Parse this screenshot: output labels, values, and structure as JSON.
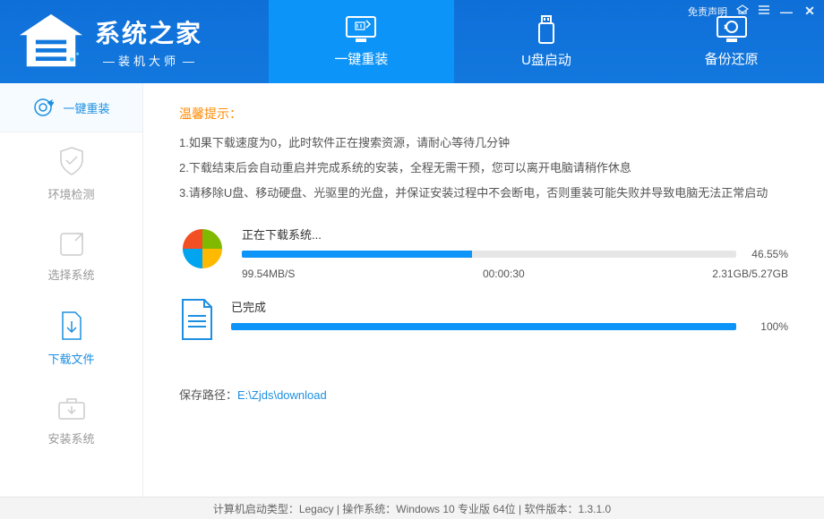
{
  "header": {
    "logo_title": "系统之家",
    "logo_sub": "装机大师",
    "tabs": [
      {
        "label": "一键重装"
      },
      {
        "label": "U盘启动"
      },
      {
        "label": "备份还原"
      }
    ],
    "disclaimer": "免责声明"
  },
  "sidebar": {
    "items": [
      {
        "label": "一键重装"
      },
      {
        "label": "环境检测"
      },
      {
        "label": "选择系统"
      },
      {
        "label": "下载文件"
      },
      {
        "label": "安装系统"
      }
    ]
  },
  "tips": {
    "title": "温馨提示：",
    "lines": [
      "1.如果下载速度为0，此时软件正在搜索资源，请耐心等待几分钟",
      "2.下载结束后会自动重启并完成系统的安装，全程无需干预，您可以离开电脑请稍作休息",
      "3.请移除U盘、移动硬盘、光驱里的光盘，并保证安装过程中不会断电，否则重装可能失败并导致电脑无法正常启动"
    ]
  },
  "download1": {
    "title": "正在下载系统...",
    "percent": 46.55,
    "percent_label": "46.55%",
    "speed": "99.54MB/S",
    "elapsed": "00:00:30",
    "size": "2.31GB/5.27GB"
  },
  "download2": {
    "title": "已完成",
    "percent": 100,
    "percent_label": "100%"
  },
  "save_path": {
    "label": "保存路径：",
    "value": "E:\\Zjds\\download"
  },
  "footer": {
    "text": "计算机启动类型：Legacy | 操作系统：Windows 10 专业版 64位 | 软件版本：1.3.1.0"
  }
}
